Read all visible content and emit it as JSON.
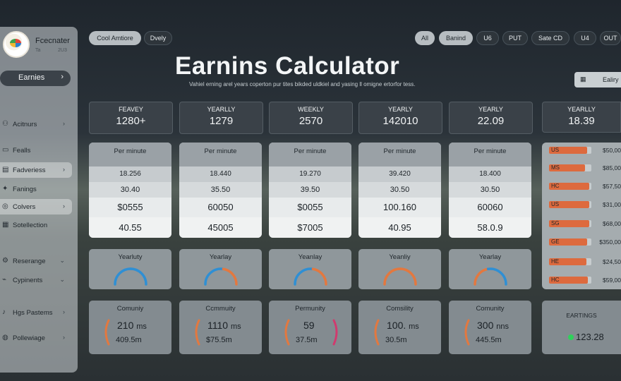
{
  "app": {
    "name": "Fcecnater",
    "sub": "Ta",
    "sub2": "2U3"
  },
  "sidebar": {
    "active": "Earnies",
    "items": [
      {
        "label": "Acitnurs",
        "icon": "people-icon",
        "chevron": true
      },
      {
        "label": "Fealls",
        "icon": "bookmark-icon",
        "chevron": false
      },
      {
        "label": "Fadveriess",
        "icon": "document-icon",
        "chevron": true,
        "highlight": true
      },
      {
        "label": "Fanings",
        "icon": "star-icon",
        "chevron": false
      },
      {
        "label": "Colvers",
        "icon": "coin-icon",
        "chevron": true,
        "highlight": true
      },
      {
        "label": "Sotellection",
        "icon": "grid-icon",
        "chevron": false
      },
      {
        "label": "Reserange",
        "icon": "gear-icon",
        "chevron": true
      },
      {
        "label": "Cypinents",
        "icon": "graph-icon",
        "chevron": true
      },
      {
        "label": "Hgs Pastems",
        "icon": "bell-icon",
        "chevron": true
      },
      {
        "label": "Pollewiage",
        "icon": "globe-icon",
        "chevron": true
      }
    ]
  },
  "top_pills_left": [
    "Cool Amtiore",
    "Dvely"
  ],
  "top_pills_right": [
    "All",
    "Banind",
    "U6",
    "PUT",
    "Sate CD",
    "U4",
    "OUT"
  ],
  "header": {
    "title": "Earnins Calculator",
    "subtitle": "Vahiel erning arel years coperton pur tites bikded uldkiel and yasing ll omigne ertorfor tess.",
    "right_button": "Ealiry"
  },
  "stat_cards": [
    {
      "label": "FEAVEY",
      "value": "1280+"
    },
    {
      "label": "YEARLLY",
      "value": "1279"
    },
    {
      "label": "WEEKLY",
      "value": "2570"
    },
    {
      "label": "YEARLY",
      "value": "142010"
    },
    {
      "label": "YEARLY",
      "value": "22.09"
    }
  ],
  "right_stat": {
    "label": "YEARLLY",
    "value": "18.39"
  },
  "per_minute": [
    {
      "head": "Per minute",
      "rows": [
        "18.256",
        "30.40",
        "$0555",
        "40.55"
      ]
    },
    {
      "head": "Per minute",
      "rows": [
        "18.440",
        "35.50",
        "60050",
        "45005"
      ]
    },
    {
      "head": "Per minute",
      "rows": [
        "19.270",
        "39.50",
        "$0055",
        "$7005"
      ]
    },
    {
      "head": "Per minute",
      "rows": [
        "39.420",
        "30.50",
        "100.160",
        "40.95"
      ]
    },
    {
      "head": "Per minute",
      "rows": [
        "18.400",
        "30.50",
        "60060",
        "58.0.9"
      ]
    }
  ],
  "gauges": [
    {
      "label": "Yearluty",
      "value": 0.5,
      "colors": [
        "#2f8fd4",
        "#2f8fd4"
      ]
    },
    {
      "label": "Yearlay",
      "value": 0.55,
      "colors": [
        "#2f8fd4",
        "#e3783f"
      ]
    },
    {
      "label": "Yeanlay",
      "value": 0.55,
      "colors": [
        "#2f8fd4",
        "#e3783f"
      ]
    },
    {
      "label": "Yeanliy",
      "value": 0.5,
      "colors": [
        "#e3783f",
        "#e3783f"
      ]
    },
    {
      "label": "Yearlay",
      "value": 0.45,
      "colors": [
        "#e3783f",
        "#2f8fd4"
      ]
    }
  ],
  "community": [
    {
      "label": "Comuniy",
      "big": "210",
      "unit": "ms",
      "small": "409.5m",
      "accent": "#e3783f"
    },
    {
      "label": "Ccmmuity",
      "big": "1110",
      "unit": "ms",
      "small": "$75.5m",
      "accent": "#e3783f"
    },
    {
      "label": "Permunity",
      "big": "59",
      "unit": "",
      "small": "37.5m",
      "accent": "#e3783f",
      "accent2": "#d13a6e"
    },
    {
      "label": "Comsility",
      "big": "100.",
      "unit": "ms",
      "small": "30.5m",
      "accent": "#e3783f"
    },
    {
      "label": "Comunity",
      "big": "300",
      "unit": "nns",
      "small": "445.5m",
      "accent": "#e3783f"
    }
  ],
  "bars": [
    {
      "code": "US",
      "value": 0.9,
      "amount": "$50,00"
    },
    {
      "code": "MS",
      "value": 0.85,
      "amount": "$85,00"
    },
    {
      "code": "HC",
      "value": 0.95,
      "amount": "$57,50"
    },
    {
      "code": "US",
      "value": 0.95,
      "amount": "$31,00"
    },
    {
      "code": "SG",
      "value": 0.95,
      "amount": "$68,00"
    },
    {
      "code": "GE",
      "value": 0.9,
      "amount": "$350,00"
    },
    {
      "code": "HE",
      "value": 0.88,
      "amount": "$24,50"
    },
    {
      "code": "HC",
      "value": 0.92,
      "amount": "$59,00"
    }
  ],
  "earnings": {
    "label": "EARTINGS",
    "value": "123.28"
  },
  "colors": {
    "accent_orange": "#dd6a3e",
    "accent_blue": "#2f8fd4",
    "positive": "#2fd15a"
  }
}
